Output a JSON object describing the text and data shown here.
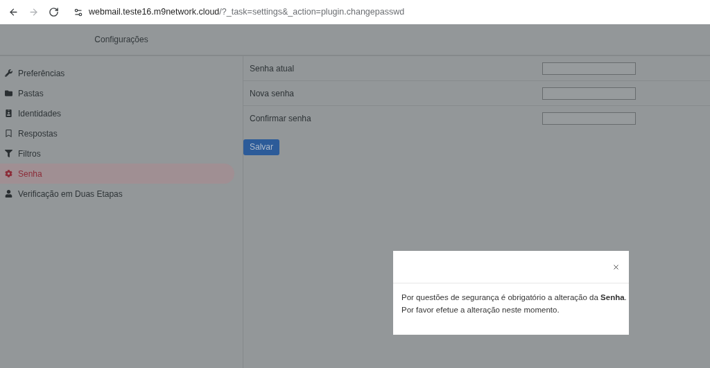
{
  "browser": {
    "navigation": [
      {
        "kind": "back",
        "disabled": false
      },
      {
        "kind": "forward",
        "disabled": true
      },
      {
        "kind": "reload",
        "disabled": false
      }
    ],
    "address": {
      "host": "webmail.teste16.m9network.cloud",
      "path": "/?_task=settings&_action=plugin.changepasswd"
    }
  },
  "header": {
    "title": "Configurações"
  },
  "sidebar": {
    "items": [
      {
        "kind": "wrench",
        "label": "Preferências",
        "selected": false
      },
      {
        "kind": "folder",
        "label": "Pastas",
        "selected": false
      },
      {
        "kind": "badge",
        "label": "Identidades",
        "selected": false
      },
      {
        "kind": "bookmark",
        "label": "Respostas",
        "selected": false
      },
      {
        "kind": "filter",
        "label": "Filtros",
        "selected": false
      },
      {
        "kind": "gear",
        "label": "Senha",
        "selected": true
      },
      {
        "kind": "user",
        "label": "Verificação em Duas Etapas",
        "selected": false
      }
    ]
  },
  "form": {
    "fields": [
      {
        "label": "Senha atual"
      },
      {
        "label": "Nova senha"
      },
      {
        "label": "Confirmar senha"
      }
    ],
    "submit": "Salvar"
  },
  "dialog": {
    "message": [
      "Por questões de segurança é obrigatório a alteração da **Senha**.",
      "Por favor efetue a alteração neste momento."
    ]
  }
}
